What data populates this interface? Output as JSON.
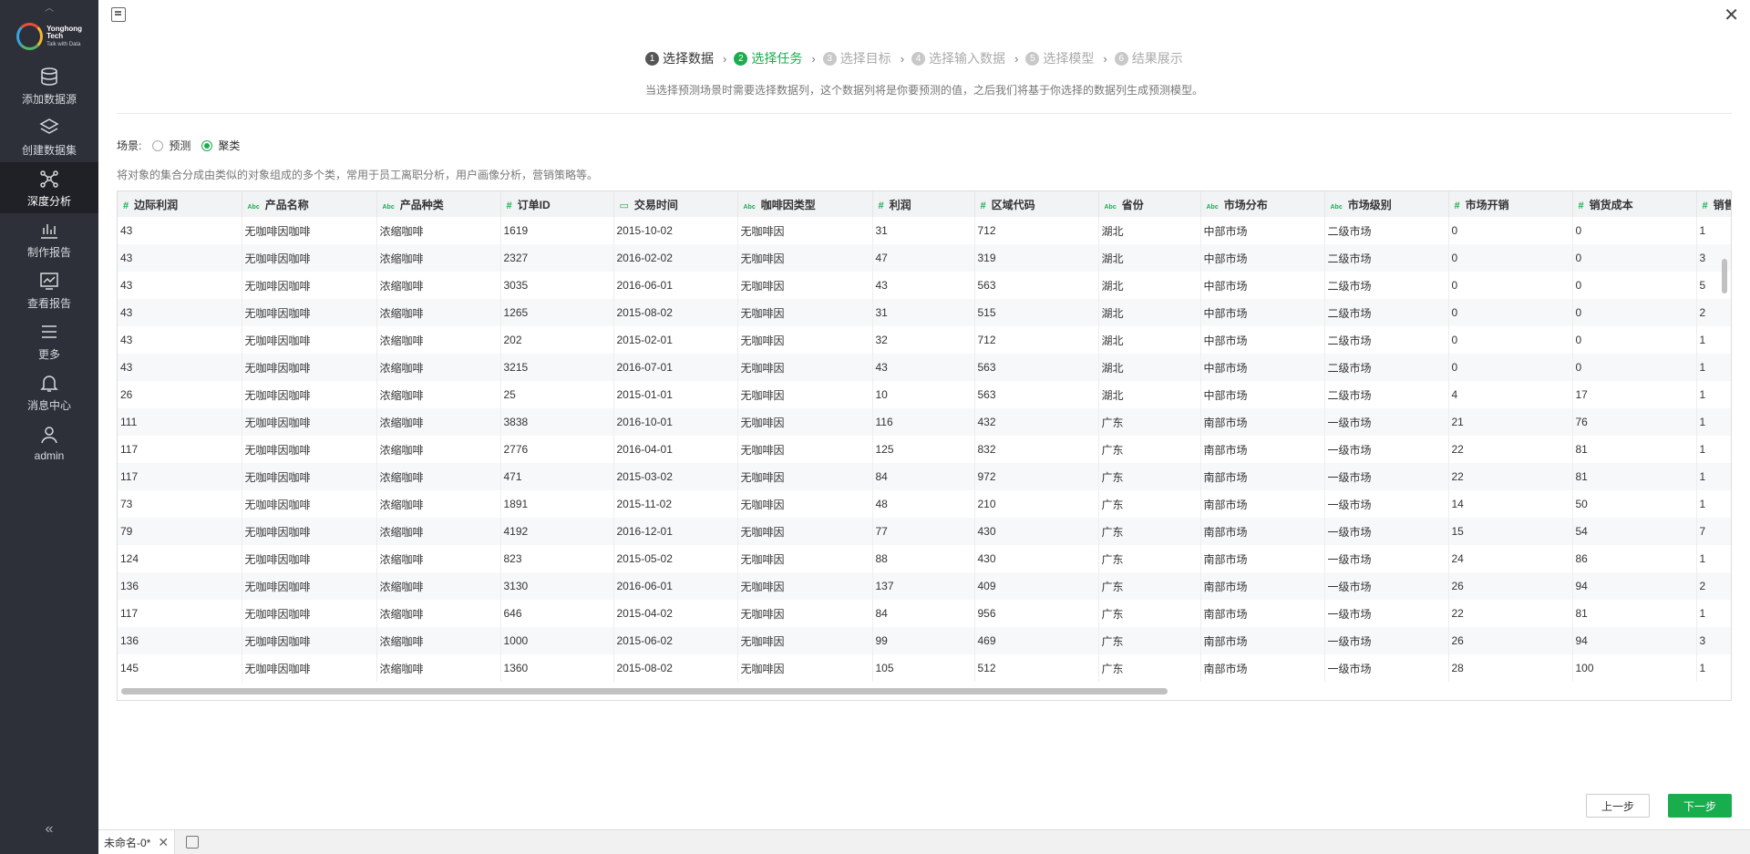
{
  "sidebar": {
    "logo": {
      "name": "Yonghong Tech",
      "tagline": "Talk with Data"
    },
    "items": [
      {
        "label": "添加数据源",
        "icon": "database-icon"
      },
      {
        "label": "创建数据集",
        "icon": "layers-icon"
      },
      {
        "label": "深度分析",
        "icon": "network-icon",
        "active": true
      },
      {
        "label": "制作报告",
        "icon": "chart-icon"
      },
      {
        "label": "查看报告",
        "icon": "line-chart-icon"
      },
      {
        "label": "更多",
        "icon": "menu-icon"
      },
      {
        "label": "消息中心",
        "icon": "bell-icon"
      },
      {
        "label": "admin",
        "icon": "user-icon"
      }
    ],
    "collapse": "«"
  },
  "steps": [
    {
      "num": "1",
      "label": "选择数据",
      "state": "done"
    },
    {
      "num": "2",
      "label": "选择任务",
      "state": "active"
    },
    {
      "num": "3",
      "label": "选择目标",
      "state": "todo"
    },
    {
      "num": "4",
      "label": "选择输入数据",
      "state": "todo"
    },
    {
      "num": "5",
      "label": "选择模型",
      "state": "todo"
    },
    {
      "num": "6",
      "label": "结果展示",
      "state": "todo"
    }
  ],
  "hint": "当选择预测场景时需要选择数据列，这个数据列将是你要预测的值，之后我们将基于你选择的数据列生成预测模型。",
  "scene": {
    "label": "场景:",
    "options": [
      {
        "label": "预测",
        "selected": false
      },
      {
        "label": "聚类",
        "selected": true
      }
    ]
  },
  "description": "将对象的集合分成由类似的对象组成的多个类，常用于员工离职分析，用户画像分析，营销策略等。",
  "table": {
    "columns": [
      {
        "name": "边际利润",
        "type": "#"
      },
      {
        "name": "产品名称",
        "type": "Abc"
      },
      {
        "name": "产品种类",
        "type": "Abc"
      },
      {
        "name": "订单ID",
        "type": "#"
      },
      {
        "name": "交易时间",
        "type": "date"
      },
      {
        "name": "咖啡因类型",
        "type": "Abc"
      },
      {
        "name": "利润",
        "type": "#"
      },
      {
        "name": "区域代码",
        "type": "#"
      },
      {
        "name": "省份",
        "type": "Abc"
      },
      {
        "name": "市场分布",
        "type": "Abc"
      },
      {
        "name": "市场级别",
        "type": "Abc"
      },
      {
        "name": "市场开销",
        "type": "#"
      },
      {
        "name": "销货成本",
        "type": "#"
      },
      {
        "name": "销售",
        "type": "#"
      }
    ],
    "rows": [
      [
        "43",
        "无咖啡因咖啡",
        "浓缩咖啡",
        "1619",
        "2015-10-02",
        "无咖啡因",
        "31",
        "712",
        "湖北",
        "中部市场",
        "二级市场",
        "0",
        "0",
        "1"
      ],
      [
        "43",
        "无咖啡因咖啡",
        "浓缩咖啡",
        "2327",
        "2016-02-02",
        "无咖啡因",
        "47",
        "319",
        "湖北",
        "中部市场",
        "二级市场",
        "0",
        "0",
        "3"
      ],
      [
        "43",
        "无咖啡因咖啡",
        "浓缩咖啡",
        "3035",
        "2016-06-01",
        "无咖啡因",
        "43",
        "563",
        "湖北",
        "中部市场",
        "二级市场",
        "0",
        "0",
        "5"
      ],
      [
        "43",
        "无咖啡因咖啡",
        "浓缩咖啡",
        "1265",
        "2015-08-02",
        "无咖啡因",
        "31",
        "515",
        "湖北",
        "中部市场",
        "二级市场",
        "0",
        "0",
        "2"
      ],
      [
        "43",
        "无咖啡因咖啡",
        "浓缩咖啡",
        "202",
        "2015-02-01",
        "无咖啡因",
        "32",
        "712",
        "湖北",
        "中部市场",
        "二级市场",
        "0",
        "0",
        "1"
      ],
      [
        "43",
        "无咖啡因咖啡",
        "浓缩咖啡",
        "3215",
        "2016-07-01",
        "无咖啡因",
        "43",
        "563",
        "湖北",
        "中部市场",
        "二级市场",
        "0",
        "0",
        "1"
      ],
      [
        "26",
        "无咖啡因咖啡",
        "浓缩咖啡",
        "25",
        "2015-01-01",
        "无咖啡因",
        "10",
        "563",
        "湖北",
        "中部市场",
        "二级市场",
        "4",
        "17",
        "1"
      ],
      [
        "111",
        "无咖啡因咖啡",
        "浓缩咖啡",
        "3838",
        "2016-10-01",
        "无咖啡因",
        "116",
        "432",
        "广东",
        "南部市场",
        "一级市场",
        "21",
        "76",
        "1"
      ],
      [
        "117",
        "无咖啡因咖啡",
        "浓缩咖啡",
        "2776",
        "2016-04-01",
        "无咖啡因",
        "125",
        "832",
        "广东",
        "南部市场",
        "一级市场",
        "22",
        "81",
        "1"
      ],
      [
        "117",
        "无咖啡因咖啡",
        "浓缩咖啡",
        "471",
        "2015-03-02",
        "无咖啡因",
        "84",
        "972",
        "广东",
        "南部市场",
        "一级市场",
        "22",
        "81",
        "1"
      ],
      [
        "73",
        "无咖啡因咖啡",
        "浓缩咖啡",
        "1891",
        "2015-11-02",
        "无咖啡因",
        "48",
        "210",
        "广东",
        "南部市场",
        "一级市场",
        "14",
        "50",
        "1"
      ],
      [
        "79",
        "无咖啡因咖啡",
        "浓缩咖啡",
        "4192",
        "2016-12-01",
        "无咖啡因",
        "77",
        "430",
        "广东",
        "南部市场",
        "一级市场",
        "15",
        "54",
        "7"
      ],
      [
        "124",
        "无咖啡因咖啡",
        "浓缩咖啡",
        "823",
        "2015-05-02",
        "无咖啡因",
        "88",
        "430",
        "广东",
        "南部市场",
        "一级市场",
        "24",
        "86",
        "1"
      ],
      [
        "136",
        "无咖啡因咖啡",
        "浓缩咖啡",
        "3130",
        "2016-06-01",
        "无咖啡因",
        "137",
        "409",
        "广东",
        "南部市场",
        "一级市场",
        "26",
        "94",
        "2"
      ],
      [
        "117",
        "无咖啡因咖啡",
        "浓缩咖啡",
        "646",
        "2015-04-02",
        "无咖啡因",
        "84",
        "956",
        "广东",
        "南部市场",
        "一级市场",
        "22",
        "81",
        "1"
      ],
      [
        "136",
        "无咖啡因咖啡",
        "浓缩咖啡",
        "1000",
        "2015-06-02",
        "无咖啡因",
        "99",
        "469",
        "广东",
        "南部市场",
        "一级市场",
        "26",
        "94",
        "3"
      ],
      [
        "145",
        "无咖啡因咖啡",
        "浓缩咖啡",
        "1360",
        "2015-08-02",
        "无咖啡因",
        "105",
        "512",
        "广东",
        "南部市场",
        "一级市场",
        "28",
        "100",
        "1"
      ]
    ]
  },
  "buttons": {
    "prev": "上一步",
    "next": "下一步"
  },
  "statusbar": {
    "tab": "未命名-0*"
  }
}
